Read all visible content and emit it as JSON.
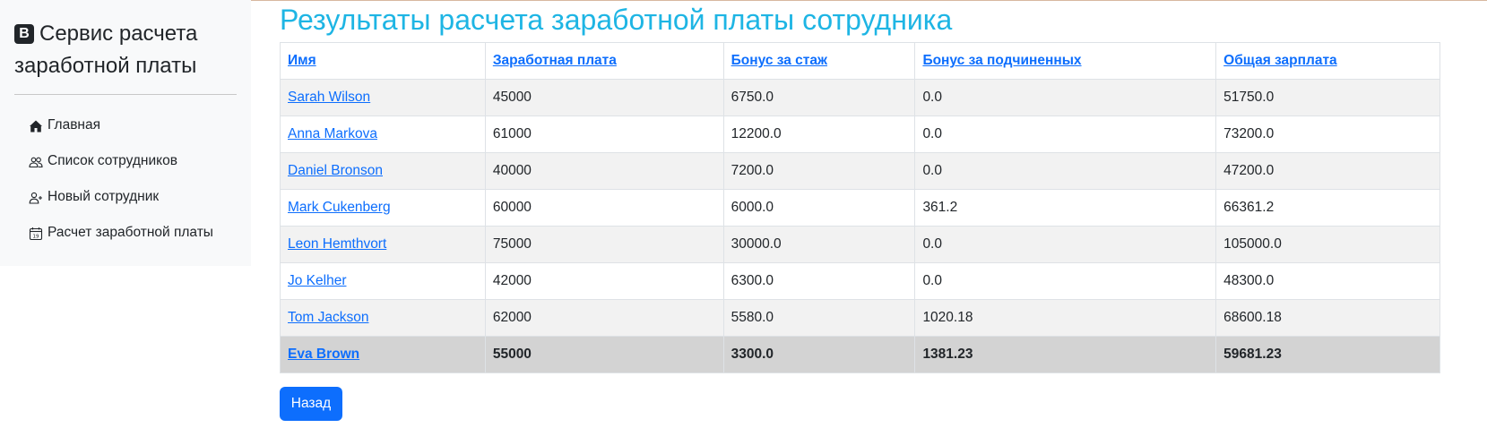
{
  "sidebar": {
    "brand_logo": "B",
    "brand_title": "Сервис расчета заработной платы",
    "items": [
      {
        "label": "Главная",
        "icon": "house-icon"
      },
      {
        "label": "Список сотрудников",
        "icon": "people-icon"
      },
      {
        "label": "Новый сотрудник",
        "icon": "person-plus-icon"
      },
      {
        "label": "Расчет заработной платы",
        "icon": "calendar-icon"
      }
    ]
  },
  "main": {
    "title": "Результаты расчета заработной платы сотрудника",
    "table": {
      "headers": [
        "Имя",
        "Заработная плата",
        "Бонус за стаж",
        "Бонус за подчиненных",
        "Общая зарплата"
      ],
      "rows": [
        [
          "Sarah Wilson",
          "45000",
          "6750.0",
          "0.0",
          "51750.0"
        ],
        [
          "Anna Markova",
          "61000",
          "12200.0",
          "0.0",
          "73200.0"
        ],
        [
          "Daniel Bronson",
          "40000",
          "7200.0",
          "0.0",
          "47200.0"
        ],
        [
          "Mark Cukenberg",
          "60000",
          "6000.0",
          "361.2",
          "66361.2"
        ],
        [
          "Leon Hemthvort",
          "75000",
          "30000.0",
          "0.0",
          "105000.0"
        ],
        [
          "Jo Kelher",
          "42000",
          "6300.0",
          "0.0",
          "48300.0"
        ],
        [
          "Tom Jackson",
          "62000",
          "5580.0",
          "1020.18",
          "68600.18"
        ],
        [
          "Eva Brown",
          "55000",
          "3300.0",
          "1381.23",
          "59681.23"
        ]
      ]
    },
    "back_button": "Назад"
  },
  "colors": {
    "title": "#1eb5e4",
    "link": "#0d6efd",
    "button": "#0d6efd",
    "sidebar_bg": "#f8f9fa",
    "highlight_row": "#d3d3d3"
  }
}
